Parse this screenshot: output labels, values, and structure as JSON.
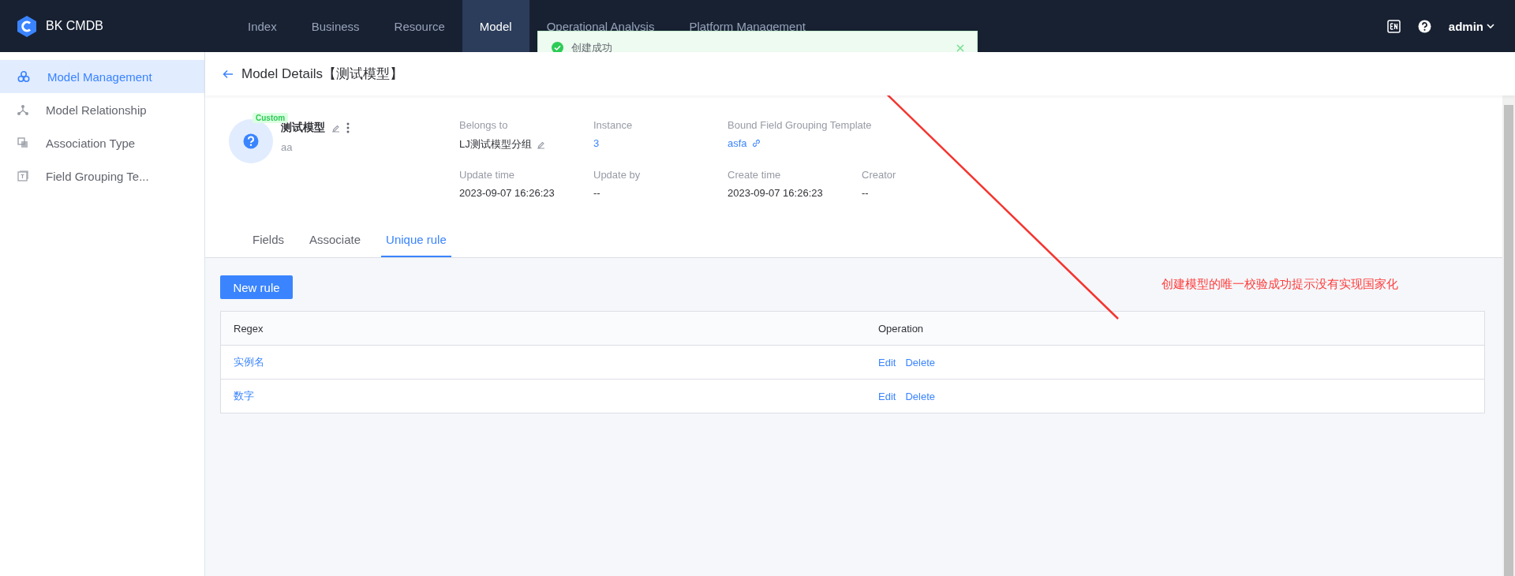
{
  "topbar": {
    "brand": "BK CMDB",
    "nav": [
      {
        "label": "Index",
        "selected": false
      },
      {
        "label": "Business",
        "selected": false
      },
      {
        "label": "Resource",
        "selected": false
      },
      {
        "label": "Model",
        "selected": true
      },
      {
        "label": "Operational Analysis",
        "selected": false
      },
      {
        "label": "Platform Management",
        "selected": false
      }
    ],
    "user": "admin"
  },
  "toast": {
    "kind": "success",
    "message": "创建成功"
  },
  "sidebar": {
    "items": [
      {
        "label": "Model Management",
        "selected": true
      },
      {
        "label": "Model Relationship",
        "selected": false
      },
      {
        "label": "Association Type",
        "selected": false
      },
      {
        "label": "Field Grouping Te...",
        "selected": false
      }
    ]
  },
  "page_title": "Model Details【测试模型】",
  "model": {
    "tag": "Custom",
    "name": "测试模型",
    "id": "aa",
    "info_rows": [
      [
        {
          "label": "Belongs to",
          "value": "LJ测试模型分组",
          "kind": "editable"
        },
        {
          "label": "Instance",
          "value": "3",
          "kind": "link"
        },
        {
          "label": "Bound Field Grouping Template",
          "value": "asfa",
          "kind": "linked"
        }
      ],
      [
        {
          "label": "Update time",
          "value": "2023-09-07 16:26:23",
          "kind": "text"
        },
        {
          "label": "Update by",
          "value": "--",
          "kind": "text"
        },
        {
          "label": "Create time",
          "value": "2023-09-07 16:26:23",
          "kind": "text"
        },
        {
          "label": "Creator",
          "value": "--",
          "kind": "text"
        }
      ]
    ]
  },
  "tabs": [
    {
      "label": "Fields",
      "selected": false
    },
    {
      "label": "Associate",
      "selected": false
    },
    {
      "label": "Unique rule",
      "selected": true
    }
  ],
  "new_button": "New rule",
  "table": {
    "columns": [
      "Regex",
      "Operation"
    ],
    "rows": [
      {
        "regex": "实例名",
        "actions": [
          "Edit",
          "Delete"
        ]
      },
      {
        "regex": "数字",
        "actions": [
          "Edit",
          "Delete"
        ]
      }
    ]
  },
  "annotation": "创建模型的唯一校验成功提示没有实现国家化"
}
